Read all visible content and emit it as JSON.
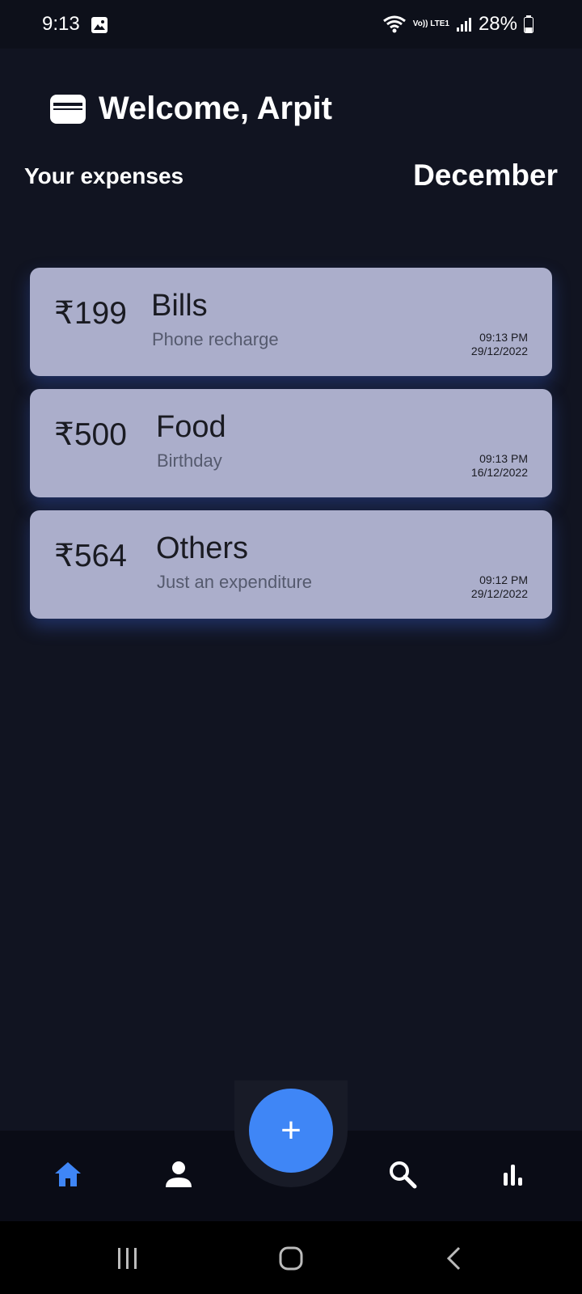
{
  "status_bar": {
    "time": "9:13",
    "network": "Vo)) LTE1",
    "battery": "28%",
    "icons": [
      "gallery-icon",
      "wifi-icon",
      "signal-icon",
      "battery-icon"
    ]
  },
  "header": {
    "title": "Welcome, Arpit",
    "icon": "wallet-icon"
  },
  "section": {
    "label": "Your expenses",
    "month": "December"
  },
  "expenses": [
    {
      "amount": "₹199",
      "category": "Bills",
      "note": "Phone recharge",
      "time": "09:13 PM",
      "date": "29/12/2022"
    },
    {
      "amount": "₹500",
      "category": "Food",
      "note": "Birthday",
      "time": "09:13 PM",
      "date": "16/12/2022"
    },
    {
      "amount": "₹564",
      "category": "Others",
      "note": "Just an expenditure",
      "time": "09:12 PM",
      "date": "29/12/2022"
    }
  ],
  "fab": {
    "label": "+"
  },
  "bottom_nav": {
    "items": [
      "home-icon",
      "profile-icon",
      "search-icon",
      "stats-icon"
    ],
    "active_color": "#3f86f6"
  },
  "colors": {
    "background": "#111421",
    "card": "#abaecb",
    "accent": "#3f86f6"
  }
}
